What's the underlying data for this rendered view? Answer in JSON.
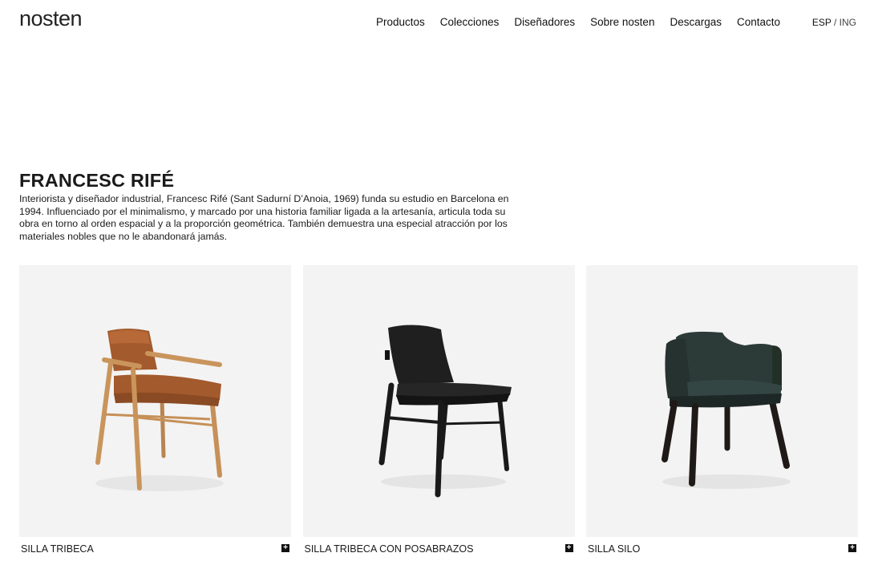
{
  "header": {
    "logo": "nosten",
    "nav": [
      "Productos",
      "Colecciones",
      "Diseñadores",
      "Sobre nosten",
      "Descargas",
      "Contacto"
    ],
    "lang_active": "ESP",
    "lang_sep": "/",
    "lang_other": "ING"
  },
  "designer": {
    "name": "FRANCESC RIFÉ",
    "bio": "Interiorista y diseñador industrial, Francesc Rifé (Sant Sadurní D’Anoia, 1969) funda su estudio en Barcelona en 1994. Influenciado por el minimalismo, y marcado por una historia familiar ligada a la artesanía, articula toda su obra en torno al orden espacial y a la proporción geométrica. También demuestra una especial atracción por los materiales nobles que no le abandonará jamás."
  },
  "products": [
    {
      "name": "SILLA TRIBECA",
      "icon": "plus-icon"
    },
    {
      "name": "SILLA TRIBECA CON POSABRAZOS",
      "icon": "plus-icon"
    },
    {
      "name": "SILLA SILO",
      "icon": "plus-icon"
    }
  ],
  "colors": {
    "card_bg": "#f3f3f3",
    "text": "#1a1a1a",
    "leather": "#a35a2c",
    "oak": "#c9955c",
    "black_chair": "#1c1c1c",
    "silo_fabric": "#2c3a38"
  }
}
